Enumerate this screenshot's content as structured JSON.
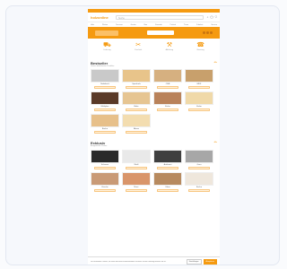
{
  "header": {
    "logo": "holzonline",
    "search_placeholder": "Suche"
  },
  "menu": [
    "Holz",
    "Platten",
    "Terrasse",
    "Garten",
    "Bau",
    "Fassade",
    "Parkett",
    "Türen",
    "Zubehör",
    "Service"
  ],
  "services": [
    {
      "icon": "truck-icon",
      "glyph": "⛟",
      "label": "Lieferung"
    },
    {
      "icon": "saw-icon",
      "glyph": "✂",
      "label": "Zuschnitt"
    },
    {
      "icon": "forklift-icon",
      "glyph": "⚒",
      "label": "Abholung"
    },
    {
      "icon": "support-icon",
      "glyph": "☎",
      "label": "Beratung"
    }
  ],
  "section1": {
    "title": "Bestseller",
    "subtitle": "Unsere beliebtesten Produkte",
    "link": "Alle",
    "tiles": [
      {
        "name": "Siebdruck",
        "color": "#c9c9c9"
      },
      {
        "name": "Sperrholz",
        "color": "#e8c48a"
      },
      {
        "name": "OSB",
        "color": "#d6b080"
      },
      {
        "name": "MDF",
        "color": "#c8a06c"
      },
      {
        "name": "Multiplex",
        "color": "#5a3a28"
      },
      {
        "name": "Birke",
        "color": "#e6c592"
      },
      {
        "name": "Eiche",
        "color": "#b9825a"
      },
      {
        "name": "Kiefer",
        "color": "#f0d9a8"
      },
      {
        "name": "Buche",
        "color": "#e7c08a"
      },
      {
        "name": "Ahorn",
        "color": "#f3ddb0"
      }
    ]
  },
  "section2": {
    "title": "Exklusiv",
    "subtitle": "Ausgewählte Platten",
    "link": "Alle",
    "tiles": [
      {
        "name": "Schwarz",
        "color": "#2a2a2a"
      },
      {
        "name": "Weiß",
        "color": "#e9e9e9"
      },
      {
        "name": "Anthrazit",
        "color": "#3f3f3f"
      },
      {
        "name": "Grau",
        "color": "#a7a7a7"
      },
      {
        "name": "Kirsche",
        "color": "#c99a76"
      },
      {
        "name": "Nuss",
        "color": "#d9956a"
      },
      {
        "name": "Ulme",
        "color": "#b78a5f"
      },
      {
        "name": "Esche",
        "color": "#efe7dc"
      }
    ]
  },
  "cookie": {
    "text": "Wir verwenden Cookies, um Ihnen das beste Einkaufserlebnis zu bieten. Mit der Nutzung stimmen Sie zu.",
    "settings": "Einstellungen",
    "accept": "Akzeptieren"
  },
  "colors": {
    "accent": "#f59a10"
  }
}
